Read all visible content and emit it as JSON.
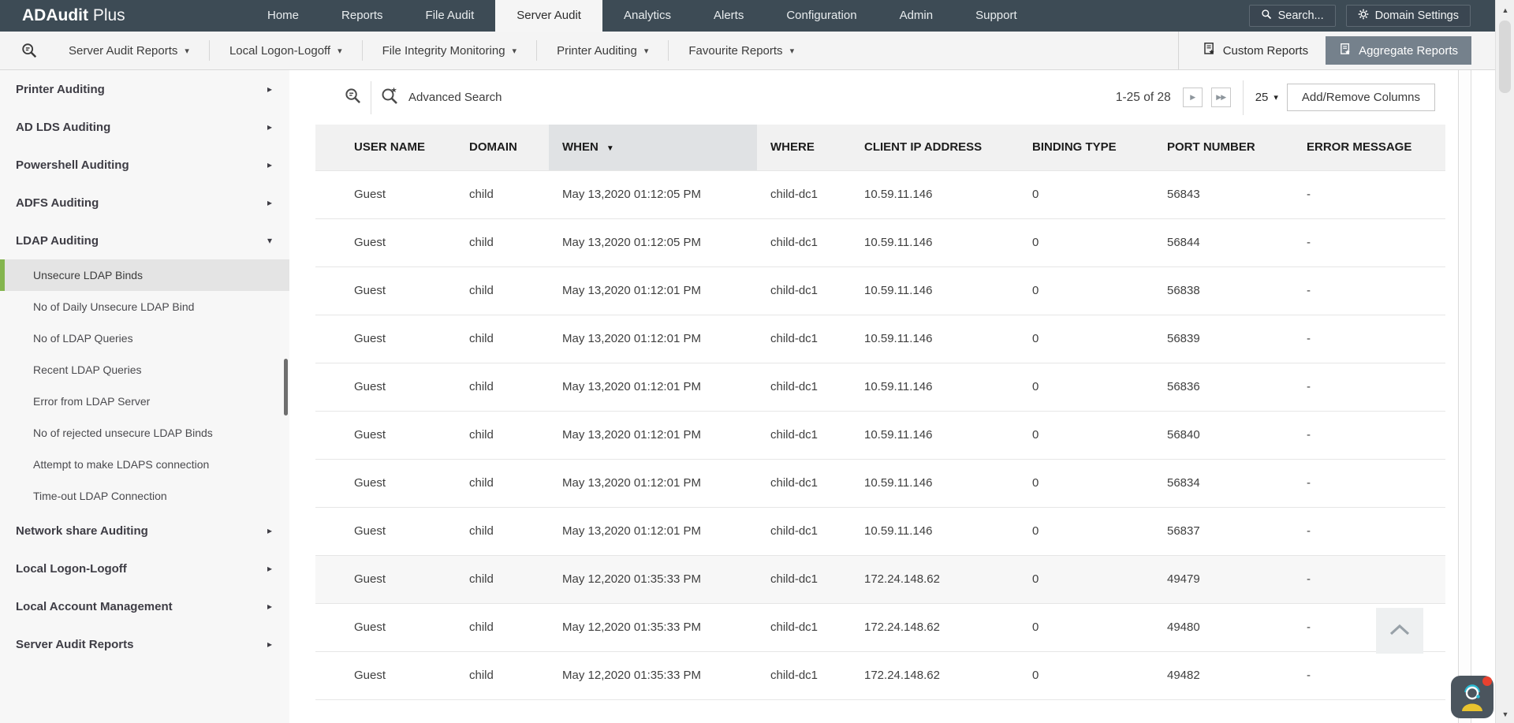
{
  "colors": {
    "navbar_bg": "#3d4b55",
    "accent_green": "#84b54e",
    "aggregate_btn_bg": "#75818c",
    "sorted_header_bg": "#e0e2e4",
    "notification_red": "#e8412f",
    "chat_teal": "#2bbcd4",
    "chat_yellow": "#e9c32f"
  },
  "brand": {
    "bold": "ADAudit",
    "light": " Plus"
  },
  "topnav": {
    "items": [
      "Home",
      "Reports",
      "File Audit",
      "Server Audit",
      "Analytics",
      "Alerts",
      "Configuration",
      "Admin",
      "Support"
    ],
    "active_item": "Server Audit",
    "search_label": "Search...",
    "domain_settings_label": "Domain Settings"
  },
  "toolbar": {
    "dropdowns": [
      "Server Audit Reports",
      "Local Logon-Logoff",
      "File Integrity Monitoring",
      "Printer Auditing",
      "Favourite Reports"
    ],
    "custom_reports_label": "Custom Reports",
    "aggregate_reports_label": "Aggregate Reports"
  },
  "sidebar": {
    "items": [
      {
        "label": "Printer Auditing",
        "type": "parent"
      },
      {
        "label": "AD LDS Auditing",
        "type": "parent"
      },
      {
        "label": "Powershell Auditing",
        "type": "parent"
      },
      {
        "label": "ADFS Auditing",
        "type": "parent"
      },
      {
        "label": "LDAP Auditing",
        "type": "parent",
        "expanded": true
      },
      {
        "label": "Unsecure LDAP Binds",
        "type": "sub",
        "selected": true
      },
      {
        "label": "No of Daily Unsecure LDAP Bind",
        "type": "sub"
      },
      {
        "label": "No of LDAP Queries",
        "type": "sub"
      },
      {
        "label": "Recent LDAP Queries",
        "type": "sub"
      },
      {
        "label": "Error from LDAP Server",
        "type": "sub"
      },
      {
        "label": "No of rejected unsecure LDAP Binds",
        "type": "sub"
      },
      {
        "label": "Attempt to make LDAPS connection",
        "type": "sub"
      },
      {
        "label": "Time-out LDAP Connection",
        "type": "sub"
      },
      {
        "label": "Network share Auditing",
        "type": "parent"
      },
      {
        "label": "Local Logon-Logoff",
        "type": "parent"
      },
      {
        "label": "Local Account Management",
        "type": "parent"
      },
      {
        "label": "Server Audit Reports",
        "type": "parent"
      }
    ]
  },
  "report": {
    "advanced_search_label": "Advanced Search",
    "pagination": {
      "range_text": "1-25 of 28",
      "page_size": "25"
    },
    "add_remove_columns_label": "Add/Remove Columns",
    "table": {
      "columns": [
        "USER NAME",
        "DOMAIN",
        "WHEN",
        "WHERE",
        "CLIENT IP ADDRESS",
        "BINDING TYPE",
        "PORT NUMBER",
        "ERROR MESSAGE"
      ],
      "sorted_column": "WHEN",
      "sort_direction": "desc",
      "shaded_row_index": 8,
      "rows": [
        [
          "Guest",
          "child",
          "May 13,2020 01:12:05 PM",
          "child-dc1",
          "10.59.11.146",
          "0",
          "56843",
          "-"
        ],
        [
          "Guest",
          "child",
          "May 13,2020 01:12:05 PM",
          "child-dc1",
          "10.59.11.146",
          "0",
          "56844",
          "-"
        ],
        [
          "Guest",
          "child",
          "May 13,2020 01:12:01 PM",
          "child-dc1",
          "10.59.11.146",
          "0",
          "56838",
          "-"
        ],
        [
          "Guest",
          "child",
          "May 13,2020 01:12:01 PM",
          "child-dc1",
          "10.59.11.146",
          "0",
          "56839",
          "-"
        ],
        [
          "Guest",
          "child",
          "May 13,2020 01:12:01 PM",
          "child-dc1",
          "10.59.11.146",
          "0",
          "56836",
          "-"
        ],
        [
          "Guest",
          "child",
          "May 13,2020 01:12:01 PM",
          "child-dc1",
          "10.59.11.146",
          "0",
          "56840",
          "-"
        ],
        [
          "Guest",
          "child",
          "May 13,2020 01:12:01 PM",
          "child-dc1",
          "10.59.11.146",
          "0",
          "56834",
          "-"
        ],
        [
          "Guest",
          "child",
          "May 13,2020 01:12:01 PM",
          "child-dc1",
          "10.59.11.146",
          "0",
          "56837",
          "-"
        ],
        [
          "Guest",
          "child",
          "May 12,2020 01:35:33 PM",
          "child-dc1",
          "172.24.148.62",
          "0",
          "49479",
          "-"
        ],
        [
          "Guest",
          "child",
          "May 12,2020 01:35:33 PM",
          "child-dc1",
          "172.24.148.62",
          "0",
          "49480",
          "-"
        ],
        [
          "Guest",
          "child",
          "May 12,2020 01:35:33 PM",
          "child-dc1",
          "172.24.148.62",
          "0",
          "49482",
          "-"
        ]
      ]
    }
  },
  "icons": {
    "gear": "⚙",
    "caret_down": "▾",
    "chevron_right": "▸",
    "chevron_down": "▾",
    "sort_desc": "▼",
    "next_page": "▶",
    "last_page": "▶▶",
    "scrollbar_up": "▲",
    "scrollbar_down": "▼"
  }
}
